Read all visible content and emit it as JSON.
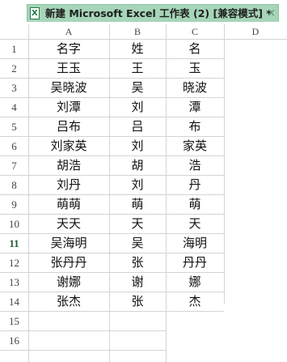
{
  "window": {
    "title": "新建 Microsoft Excel 工作表 (2)  [兼容模式] *",
    "close_glyph": "×",
    "file_icon_letter": "X"
  },
  "columns": [
    "A",
    "B",
    "C",
    "D"
  ],
  "row_numbers": [
    "1",
    "2",
    "3",
    "4",
    "5",
    "6",
    "7",
    "8",
    "9",
    "10",
    "11",
    "12",
    "13",
    "14",
    "15",
    "16"
  ],
  "rows": [
    [
      "名字",
      "姓",
      "名"
    ],
    [
      "王玉",
      "王",
      "玉"
    ],
    [
      "吴晓波",
      "吴",
      "晓波"
    ],
    [
      "刘潭",
      "刘",
      "潭"
    ],
    [
      "吕布",
      "吕",
      "布"
    ],
    [
      "刘家英",
      "刘",
      "家英"
    ],
    [
      "胡浩",
      "胡",
      "浩"
    ],
    [
      "刘丹",
      "刘",
      "丹"
    ],
    [
      "萌萌",
      "萌",
      "萌"
    ],
    [
      "天天",
      "天",
      "天"
    ],
    [
      "吴海明",
      "吴",
      "海明"
    ],
    [
      "张丹丹",
      "张",
      "丹丹"
    ],
    [
      "谢娜",
      "谢",
      "娜"
    ],
    [
      "张杰",
      "张",
      "杰"
    ]
  ]
}
